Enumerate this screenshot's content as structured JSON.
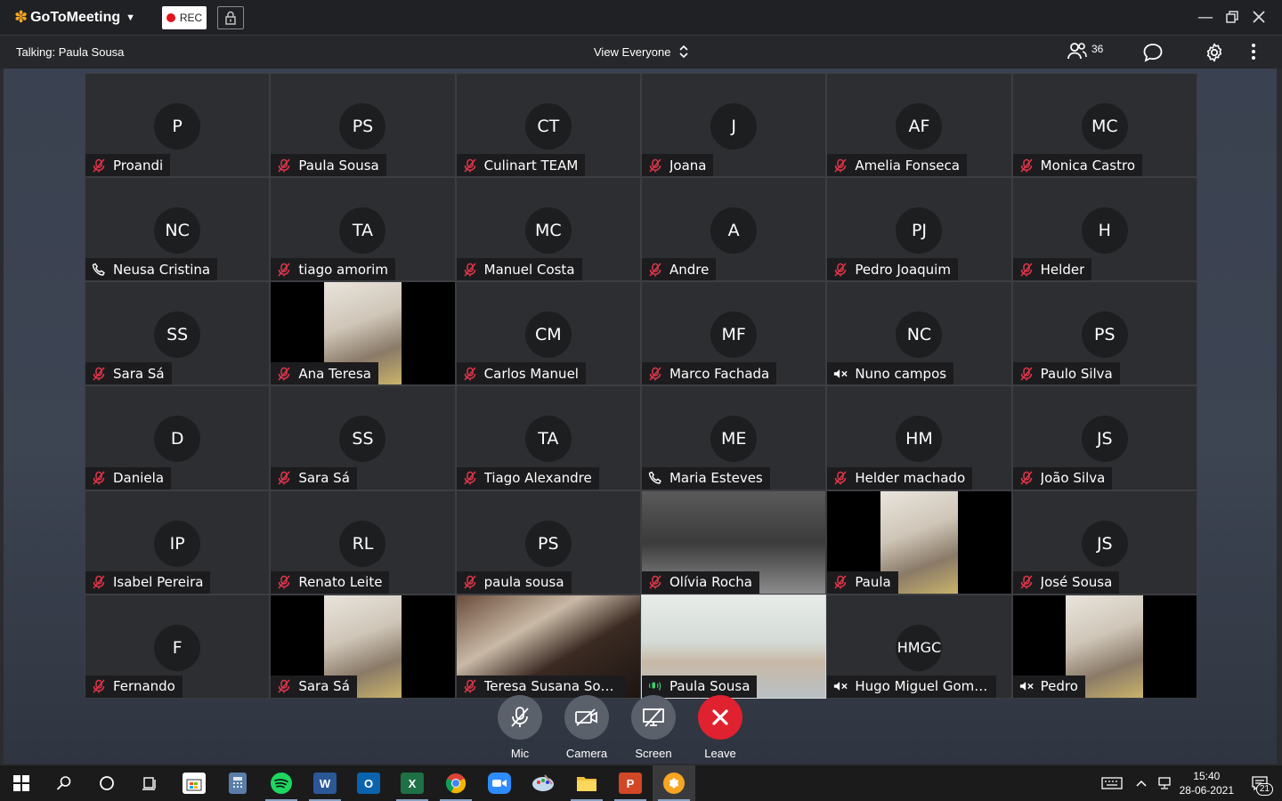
{
  "app": {
    "brand": "GoToMeeting",
    "rec_label": "REC",
    "talking": "Talking: Paula Sousa",
    "view_label": "View Everyone",
    "participant_count": "36"
  },
  "tiles": [
    {
      "initials": "P",
      "name": "Proandi",
      "status": "muted"
    },
    {
      "initials": "PS",
      "name": "Paula Sousa",
      "status": "muted"
    },
    {
      "initials": "CT",
      "name": "Culinart TEAM",
      "status": "muted"
    },
    {
      "initials": "J",
      "name": "Joana",
      "status": "muted"
    },
    {
      "initials": "AF",
      "name": "Amelia Fonseca",
      "status": "muted"
    },
    {
      "initials": "MC",
      "name": "Monica Castro",
      "status": "muted"
    },
    {
      "initials": "NC",
      "name": "Neusa Cristina",
      "status": "phone"
    },
    {
      "initials": "TA",
      "name": "tiago amorim",
      "status": "muted"
    },
    {
      "initials": "MC",
      "name": "Manuel Costa",
      "status": "muted"
    },
    {
      "initials": "A",
      "name": "Andre",
      "status": "muted"
    },
    {
      "initials": "PJ",
      "name": "Pedro Joaquim",
      "status": "muted"
    },
    {
      "initials": "H",
      "name": "Helder",
      "status": "muted"
    },
    {
      "initials": "SS",
      "name": "Sara Sá",
      "status": "muted"
    },
    {
      "initials": "",
      "name": "Ana Teresa",
      "status": "muted",
      "video": "narrow"
    },
    {
      "initials": "CM",
      "name": "Carlos Manuel",
      "status": "muted"
    },
    {
      "initials": "MF",
      "name": "Marco Fachada",
      "status": "muted"
    },
    {
      "initials": "NC",
      "name": "Nuno campos",
      "status": "speaker-off"
    },
    {
      "initials": "PS",
      "name": "Paulo Silva",
      "status": "muted"
    },
    {
      "initials": "D",
      "name": "Daniela",
      "status": "muted"
    },
    {
      "initials": "SS",
      "name": "Sara Sá",
      "status": "muted"
    },
    {
      "initials": "TA",
      "name": "Tiago Alexandre",
      "status": "muted"
    },
    {
      "initials": "ME",
      "name": "Maria Esteves",
      "status": "phone"
    },
    {
      "initials": "HM",
      "name": "Helder machado",
      "status": "muted"
    },
    {
      "initials": "JS",
      "name": "João Silva",
      "status": "muted"
    },
    {
      "initials": "IP",
      "name": "Isabel Pereira",
      "status": "muted"
    },
    {
      "initials": "RL",
      "name": "Renato Leite",
      "status": "muted"
    },
    {
      "initials": "PS",
      "name": "paula sousa",
      "status": "muted"
    },
    {
      "initials": "",
      "name": "Olívia Rocha",
      "status": "muted",
      "video": "full"
    },
    {
      "initials": "",
      "name": "Paula",
      "status": "muted",
      "video": "narrow"
    },
    {
      "initials": "JS",
      "name": "José Sousa",
      "status": "muted"
    },
    {
      "initials": "F",
      "name": "Fernando",
      "status": "muted"
    },
    {
      "initials": "",
      "name": "Sara Sá",
      "status": "muted",
      "video": "narrow"
    },
    {
      "initials": "",
      "name": "Teresa Susana Sousa",
      "status": "muted",
      "video": "full"
    },
    {
      "initials": "",
      "name": "Paula Sousa",
      "status": "talking",
      "video": "full",
      "highlight": true
    },
    {
      "initials": "HMGC",
      "name": "Hugo Miguel Gomes...",
      "status": "speaker-off"
    },
    {
      "initials": "",
      "name": "Pedro",
      "status": "speaker-off",
      "video": "narrow"
    }
  ],
  "controls": {
    "mic": "Mic",
    "camera": "Camera",
    "screen": "Screen",
    "leave": "Leave"
  },
  "taskbar": {
    "time": "15:40",
    "date": "28-06-2021",
    "notifications": "21",
    "icons": [
      "windows-start-icon",
      "search-icon",
      "cortana-icon",
      "task-view-icon",
      "store-icon",
      "calculator-icon",
      "spotify-icon",
      "word-icon",
      "outlook-icon",
      "excel-icon",
      "chrome-icon",
      "zoom-icon",
      "paint-icon",
      "file-explorer-icon",
      "powerpoint-icon",
      "gotomeeting-icon"
    ]
  },
  "colors": {
    "muted_icon": "#e0364a",
    "talking_icon": "#3ecf6a",
    "leave_button": "#e0212f",
    "rec_dot": "#e3141b",
    "brand_orange": "#f6a623"
  }
}
